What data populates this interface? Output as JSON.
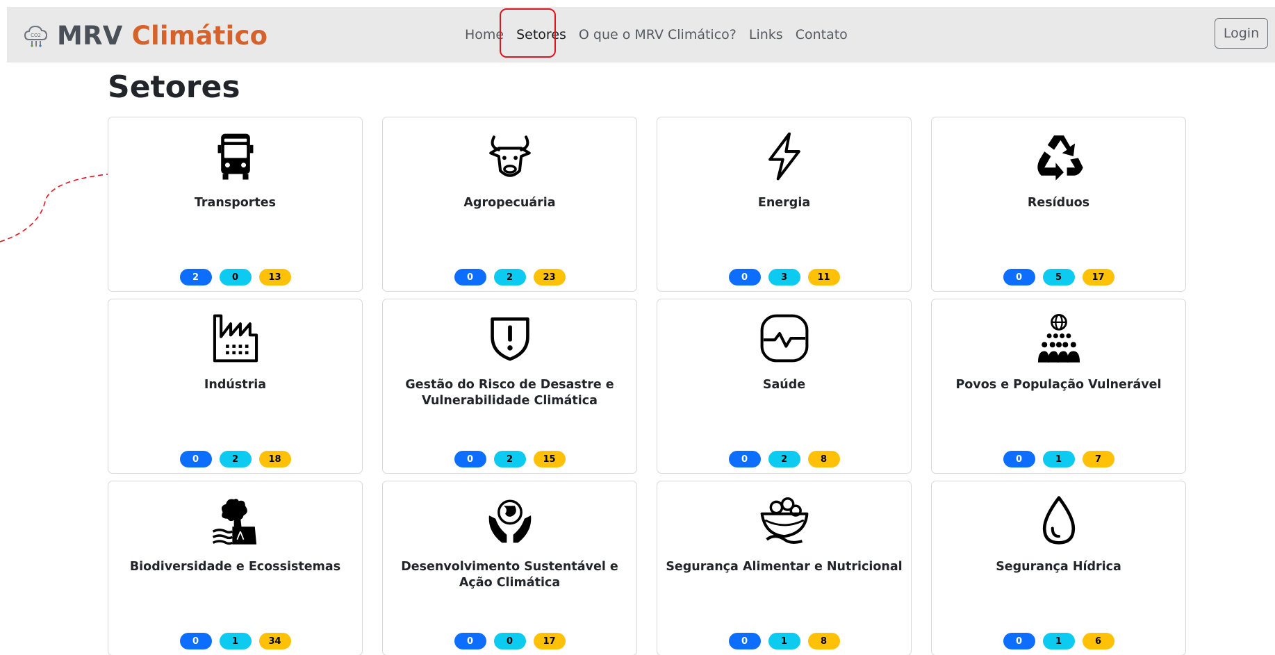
{
  "brand": {
    "part1": "MRV",
    "part2": "Climático",
    "colors": {
      "mrv": "#495057",
      "climatico": "#d4622a"
    }
  },
  "nav": {
    "items": [
      {
        "label": "Home",
        "active": false
      },
      {
        "label": "Setores",
        "active": true
      },
      {
        "label": "O que o MRV Climático?",
        "active": false
      },
      {
        "label": "Links",
        "active": false
      },
      {
        "label": "Contato",
        "active": false
      }
    ],
    "login": "Login"
  },
  "page": {
    "title": "Setores"
  },
  "sectors": [
    {
      "title": "Transportes",
      "icon": "bus-icon",
      "badges": [
        "2",
        "0",
        "13"
      ]
    },
    {
      "title": "Agropecuária",
      "icon": "cow-icon",
      "badges": [
        "0",
        "2",
        "23"
      ]
    },
    {
      "title": "Energia",
      "icon": "lightning-icon",
      "badges": [
        "0",
        "3",
        "11"
      ]
    },
    {
      "title": "Resíduos",
      "icon": "recycle-icon",
      "badges": [
        "0",
        "5",
        "17"
      ]
    },
    {
      "title": "Indústria",
      "icon": "factory-icon",
      "badges": [
        "0",
        "2",
        "18"
      ]
    },
    {
      "title": "Gestão do Risco de Desastre e Vulnerabilidade Climática",
      "icon": "shield-exclamation-icon",
      "badges": [
        "0",
        "2",
        "15"
      ]
    },
    {
      "title": "Saúde",
      "icon": "heart-monitor-icon",
      "badges": [
        "0",
        "2",
        "8"
      ]
    },
    {
      "title": "Povos e População Vulnerável",
      "icon": "people-globe-icon",
      "badges": [
        "0",
        "1",
        "7"
      ]
    },
    {
      "title": "Biodiversidade e Ecossistemas",
      "icon": "tree-water-icon",
      "badges": [
        "0",
        "1",
        "34"
      ]
    },
    {
      "title": "Desenvolvimento Sustentável e Ação Climática",
      "icon": "hands-globe-icon",
      "badges": [
        "0",
        "0",
        "17"
      ]
    },
    {
      "title": "Segurança Alimentar e Nutricional",
      "icon": "food-basket-icon",
      "badges": [
        "0",
        "1",
        "8"
      ]
    },
    {
      "title": "Segurança Hídrica",
      "icon": "water-drop-icon",
      "badges": [
        "0",
        "1",
        "6"
      ]
    }
  ],
  "badge_colors": {
    "blue": "#0d6efd",
    "cyan": "#0dcaf0",
    "yellow": "#ffc107"
  },
  "highlight_color": "#e0141c"
}
